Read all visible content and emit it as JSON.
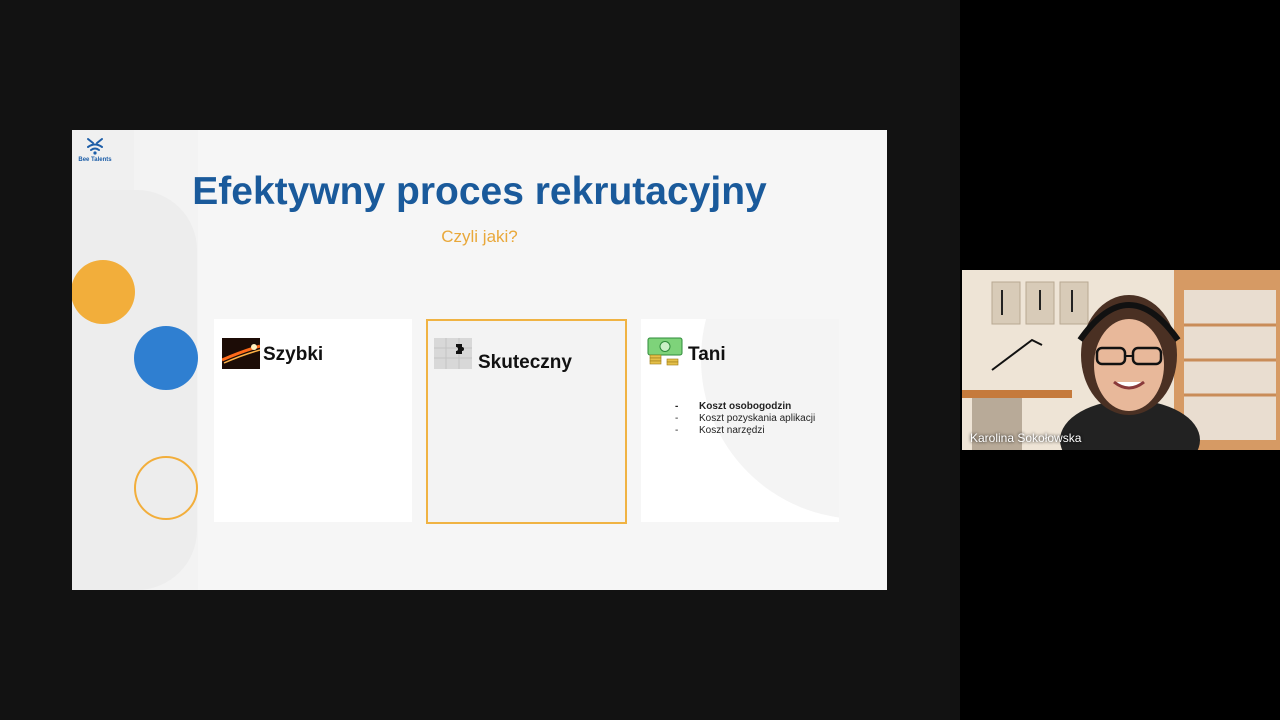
{
  "slide": {
    "logo_text": "Bee Talents",
    "title": "Efektywny proces rekrutacyjny",
    "subtitle": "Czyli jaki?",
    "cards": [
      {
        "heading": "Szybki",
        "image": "rocket-image"
      },
      {
        "heading": "Skuteczny",
        "image": "puzzle-image"
      },
      {
        "heading": "Tani",
        "image": "money-image",
        "items": [
          "Koszt osobogodzin",
          "Koszt pozyskania aplikacji",
          "Koszt narzędzi"
        ]
      }
    ]
  },
  "participant": {
    "name": "Karolina Sokołowska"
  },
  "colors": {
    "title_blue": "#1a5a9b",
    "accent_yellow": "#f2ae3b",
    "accent_blue": "#2f7fd1",
    "highlight_border": "#f0b343"
  }
}
